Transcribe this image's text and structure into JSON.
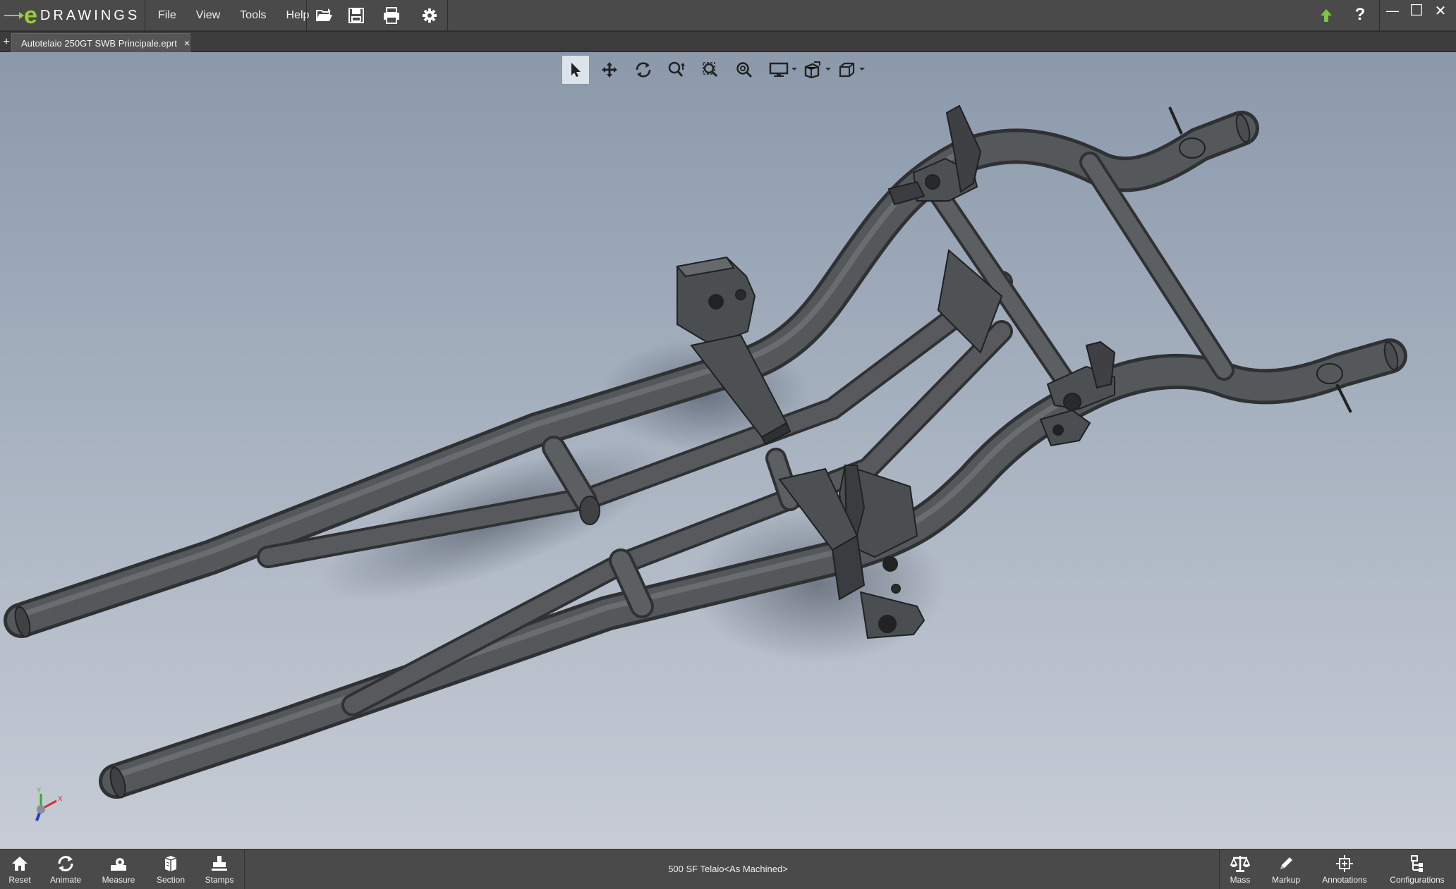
{
  "app": {
    "logo_letter": "e",
    "logo_word": "DRAWINGS",
    "logo_reg": "®"
  },
  "menu": [
    "File",
    "View",
    "Tools",
    "Help"
  ],
  "quick_access": [
    "open-icon",
    "save-icon",
    "print-icon",
    "settings-icon"
  ],
  "window_controls": {
    "update_icon": "up-arrow-icon",
    "help": "?",
    "minimize": "—",
    "maximize": "☐",
    "close": "✕"
  },
  "tabs": {
    "add": "+",
    "document": "Autotelaio 250GT SWB Principale.eprt",
    "close": "×"
  },
  "view_toolbar": [
    {
      "name": "select",
      "icon": "pointer-icon",
      "active": true
    },
    {
      "name": "pan",
      "icon": "pan-icon"
    },
    {
      "name": "rotate",
      "icon": "rotate-icon"
    },
    {
      "name": "zoom",
      "icon": "zoom-icon"
    },
    {
      "name": "zoom-to-area",
      "icon": "zoom-area-icon"
    },
    {
      "name": "zoom-to-fit",
      "icon": "zoom-fit-icon"
    },
    {
      "name": "display-style",
      "icon": "monitor-icon",
      "dropdown": true
    },
    {
      "name": "views",
      "icon": "views-icon",
      "dropdown": true
    },
    {
      "name": "view-orientation",
      "icon": "cube-icon",
      "dropdown": true
    }
  ],
  "triad": {
    "x": "X",
    "y": "Y",
    "z": "Z"
  },
  "bottom_left": [
    {
      "label": "Reset",
      "icon": "home-icon"
    },
    {
      "label": "Animate",
      "icon": "animate-icon"
    },
    {
      "label": "Measure",
      "icon": "measure-icon"
    },
    {
      "label": "Section",
      "icon": "section-icon"
    },
    {
      "label": "Stamps",
      "icon": "stamps-icon"
    }
  ],
  "status": "500 SF Telaio<As Machined>",
  "bottom_right": [
    {
      "label": "Mass",
      "icon": "scale-icon"
    },
    {
      "label": "Markup",
      "icon": "pencil-icon"
    },
    {
      "label": "Annotations",
      "icon": "annotations-icon"
    },
    {
      "label": "Configurations",
      "icon": "configurations-icon"
    }
  ],
  "colors": {
    "accent_green": "#9acd32",
    "bar": "#4a4a4a",
    "tube": "#4d4f51",
    "bg_top": "#8b99ab",
    "bg_bottom": "#c7ccd6"
  }
}
